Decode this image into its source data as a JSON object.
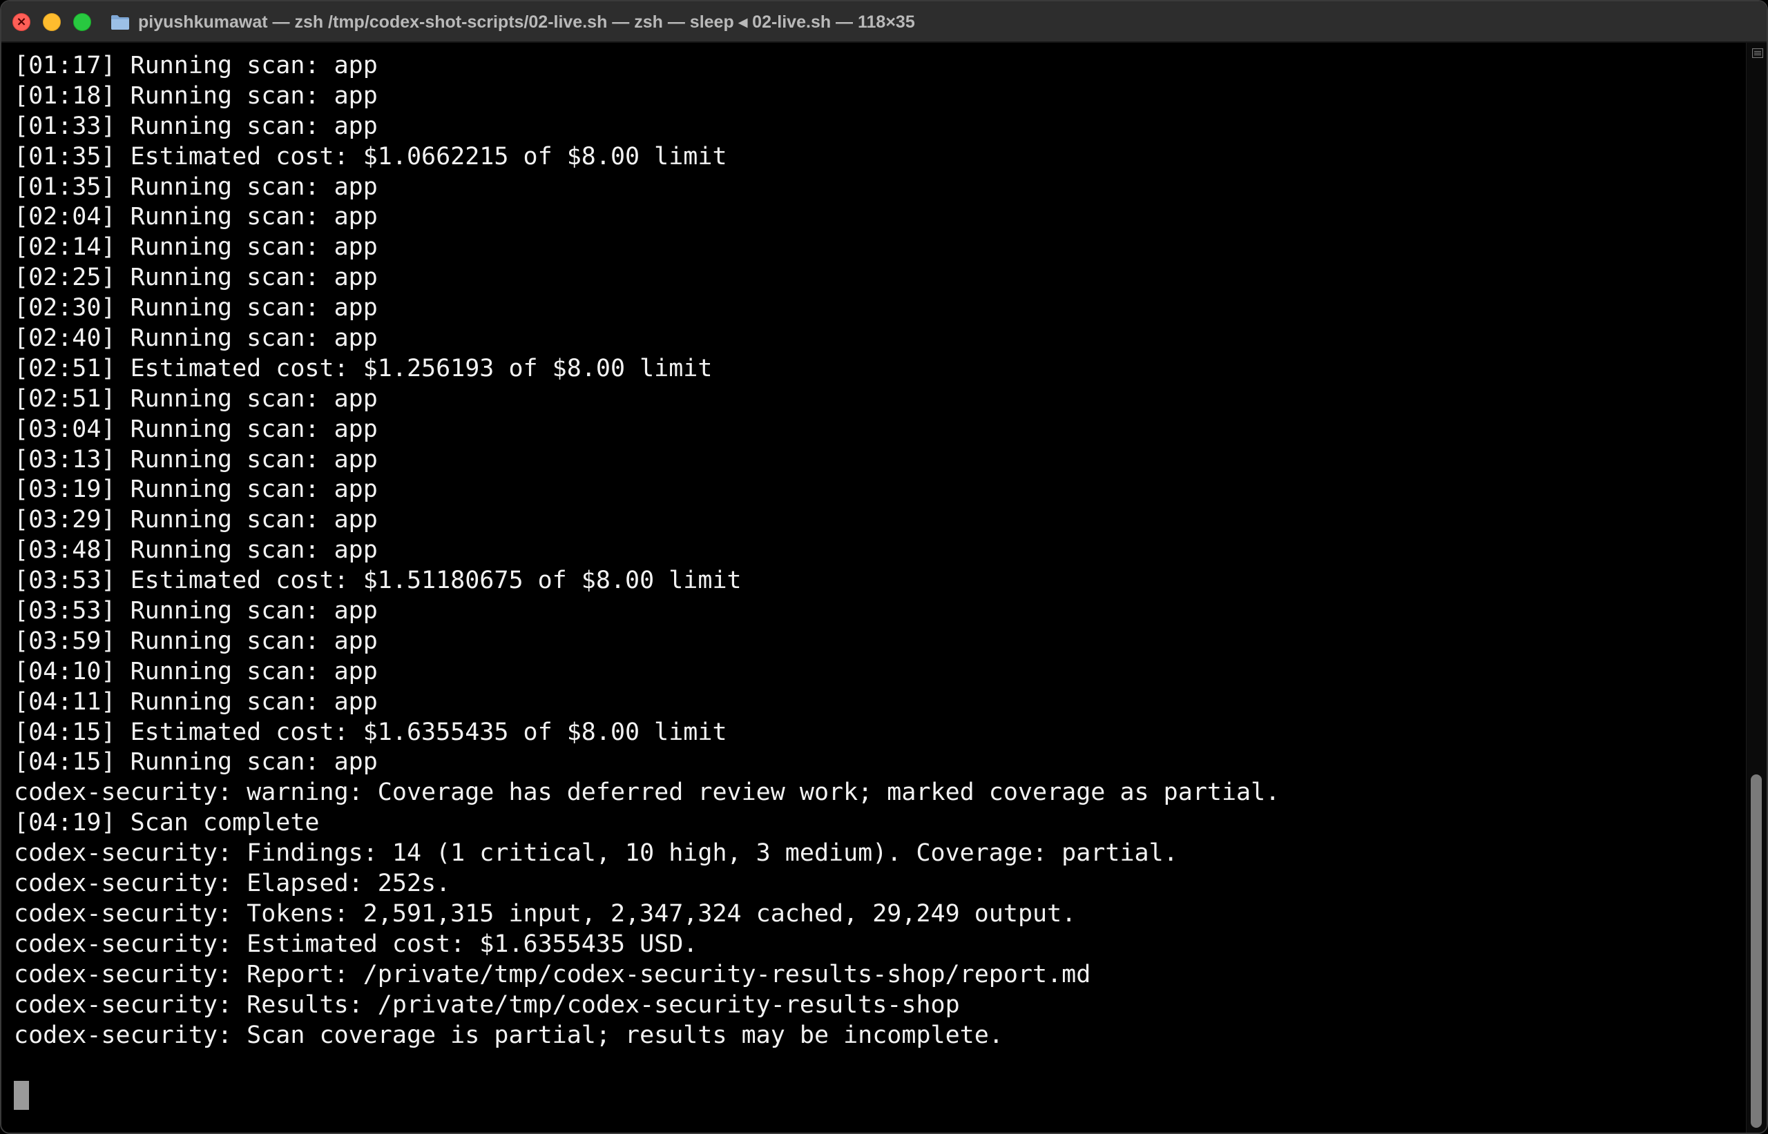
{
  "window": {
    "title": "piyushkumawat — zsh /tmp/codex-shot-scripts/02-live.sh — zsh — sleep ◂ 02-live.sh — 118×35"
  },
  "colors": {
    "background": "#000000",
    "text": "#f2f2f2",
    "titlebar": "#2d2d2d",
    "close": "#ff5f57",
    "minimize": "#febc2e",
    "zoom": "#28c840",
    "folder": "#7fa8d6"
  },
  "icons": {
    "title": "folder-icon",
    "close": "close-icon",
    "scroll": "scroll-marker-icon"
  },
  "terminal": {
    "lines": [
      "[01:17] Running scan: app",
      "[01:18] Running scan: app",
      "[01:33] Running scan: app",
      "[01:35] Estimated cost: $1.0662215 of $8.00 limit",
      "[01:35] Running scan: app",
      "[02:04] Running scan: app",
      "[02:14] Running scan: app",
      "[02:25] Running scan: app",
      "[02:30] Running scan: app",
      "[02:40] Running scan: app",
      "[02:51] Estimated cost: $1.256193 of $8.00 limit",
      "[02:51] Running scan: app",
      "[03:04] Running scan: app",
      "[03:13] Running scan: app",
      "[03:19] Running scan: app",
      "[03:29] Running scan: app",
      "[03:48] Running scan: app",
      "[03:53] Estimated cost: $1.51180675 of $8.00 limit",
      "[03:53] Running scan: app",
      "[03:59] Running scan: app",
      "[04:10] Running scan: app",
      "[04:11] Running scan: app",
      "[04:15] Estimated cost: $1.6355435 of $8.00 limit",
      "[04:15] Running scan: app",
      "codex-security: warning: Coverage has deferred review work; marked coverage as partial.",
      "[04:19] Scan complete",
      "codex-security: Findings: 14 (1 critical, 10 high, 3 medium). Coverage: partial.",
      "codex-security: Elapsed: 252s.",
      "codex-security: Tokens: 2,591,315 input, 2,347,324 cached, 29,249 output.",
      "codex-security: Estimated cost: $1.6355435 USD.",
      "codex-security: Report: /private/tmp/codex-security-results-shop/report.md",
      "codex-security: Results: /private/tmp/codex-security-results-shop",
      "codex-security: Scan coverage is partial; results may be incomplete.",
      "",
      ""
    ]
  }
}
